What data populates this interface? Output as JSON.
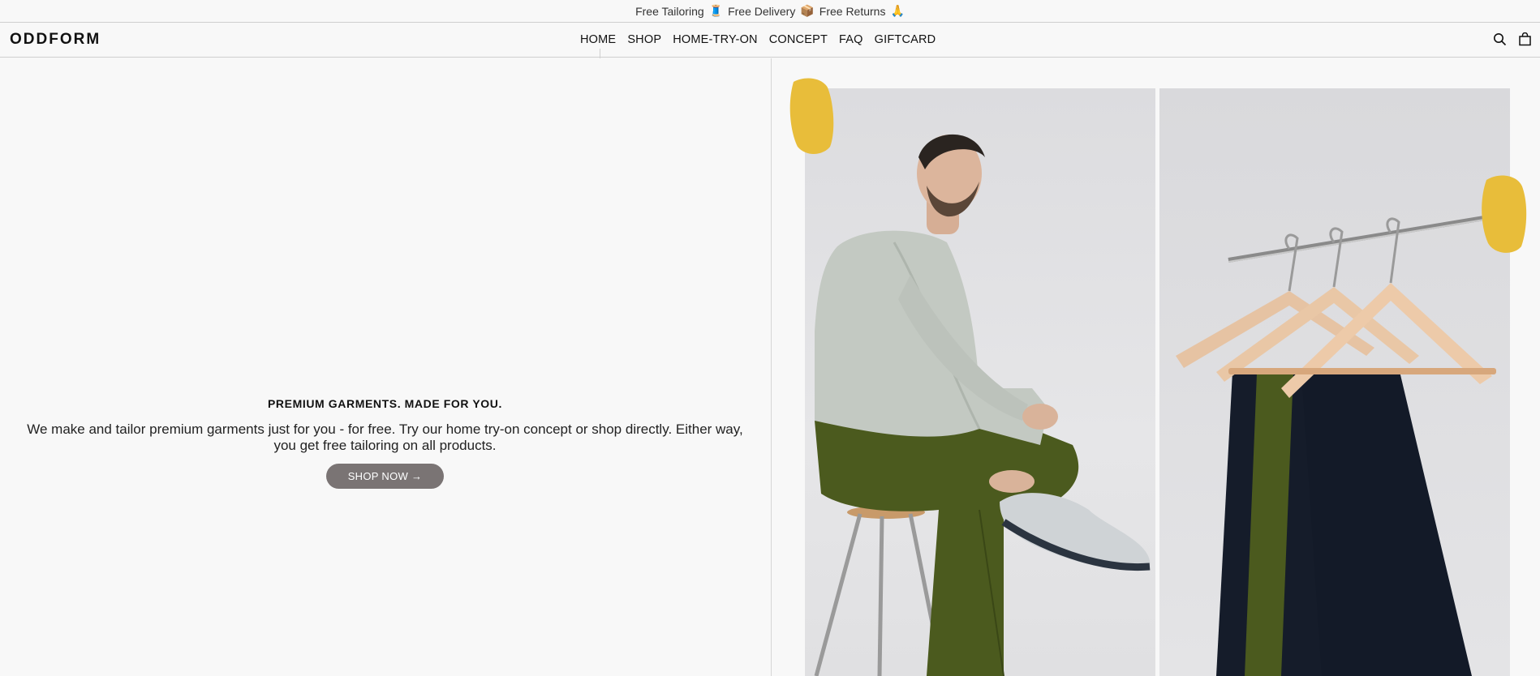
{
  "announcement": {
    "parts": [
      "Free Tailoring",
      "🧵",
      "Free Delivery",
      "📦",
      "Free Returns",
      "🙏"
    ]
  },
  "header": {
    "logo": "ODDFORM",
    "nav": [
      "HOME",
      "SHOP",
      "HOME-TRY-ON",
      "CONCEPT",
      "FAQ",
      "GIFTCARD"
    ],
    "icons": [
      "search-icon",
      "bag-icon"
    ]
  },
  "hero": {
    "title": "PREMIUM GARMENTS. MADE FOR YOU.",
    "subtitle": "We make and tailor premium garments just for you - for free. Try our home try-on concept or shop directly. Either way, you get free tailoring on all products.",
    "button": "SHOP NOW →"
  },
  "colors": {
    "background": "#f8f8f8",
    "button": "#7a7474",
    "accent_yellow": "#e8bd3a",
    "trousers_olive": "#4b5a1e",
    "trousers_navy": "#151c2a"
  }
}
